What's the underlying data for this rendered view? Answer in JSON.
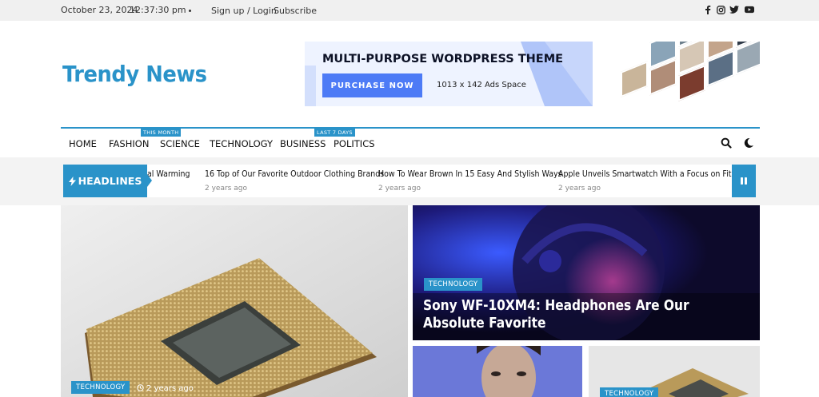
{
  "topbar": {
    "date": "October 23, 2024",
    "time": "12:37:30 pm",
    "signup_login": "Sign up / Login",
    "subscribe": "Subscribe",
    "social": [
      "facebook-icon",
      "instagram-icon",
      "twitter-icon",
      "youtube-icon"
    ]
  },
  "header": {
    "logo": "Trendy News",
    "ad": {
      "title": "MULTI-PURPOSE WORDPRESS THEME",
      "button": "PURCHASE NOW",
      "size": "1013 x 142 Ads Space"
    }
  },
  "nav": {
    "items": [
      {
        "label": "HOME"
      },
      {
        "label": "FASHION"
      },
      {
        "label": "SCIENCE",
        "tag": "THIS MONTH"
      },
      {
        "label": "TECHNOLOGY"
      },
      {
        "label": "BUSINESS"
      },
      {
        "label": "POLITICS",
        "tag": "LAST 7 DAYS"
      }
    ],
    "search_icon": "search-icon",
    "dark_mode_icon": "moon-icon"
  },
  "ticker": {
    "label": "HEADLINES",
    "items": [
      {
        "title": "bal Warming",
        "ago": ""
      },
      {
        "title": "16 Top of Our Favorite Outdoor Clothing Brands",
        "ago": "2 years ago"
      },
      {
        "title": "How To Wear Brown In 15 Easy And Stylish Ways",
        "ago": "2 years ago"
      },
      {
        "title": "Apple Unveils Smartwatch With a Focus on Fitness",
        "ago": "2 years ago"
      }
    ]
  },
  "cards": {
    "main": {
      "category": "TECHNOLOGY",
      "ago": "2 years ago"
    },
    "top_right": {
      "category": "TECHNOLOGY",
      "title": "Sony WF-10XM4: Headphones Are Our Absolute Favorite"
    },
    "bottom_right": {
      "category": "TECHNOLOGY"
    }
  },
  "colors": {
    "accent": "#2a93c9",
    "ad_button": "#4d7bf6",
    "topbar_bg": "#f0f0f0"
  }
}
